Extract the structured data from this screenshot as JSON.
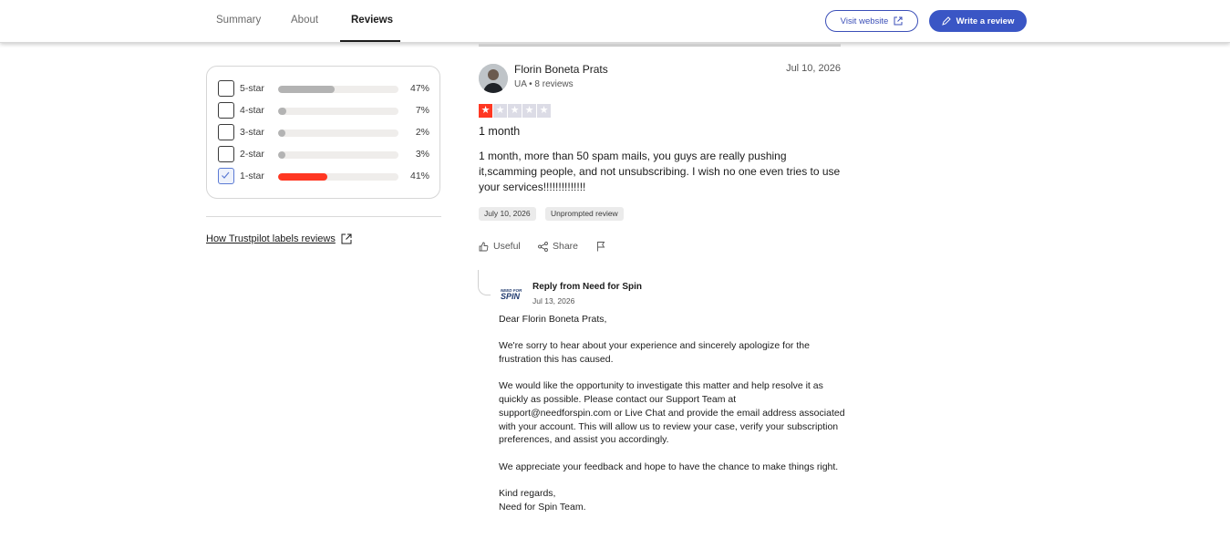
{
  "nav": {
    "tabs": [
      {
        "label": "Summary"
      },
      {
        "label": "About"
      },
      {
        "label": "Reviews"
      }
    ],
    "visit_label": "Visit website",
    "write_label": "Write a review"
  },
  "filters": [
    {
      "label": "5-star",
      "percent": "47%",
      "fraction": 0.47,
      "checked": false,
      "color": "#b3b3b3"
    },
    {
      "label": "4-star",
      "percent": "7%",
      "fraction": 0.07,
      "checked": false,
      "color": "#b3b3b3"
    },
    {
      "label": "3-star",
      "percent": "2%",
      "fraction": 0.02,
      "checked": false,
      "color": "#b3b3b3"
    },
    {
      "label": "2-star",
      "percent": "3%",
      "fraction": 0.03,
      "checked": false,
      "color": "#b3b3b3"
    },
    {
      "label": "1-star",
      "percent": "41%",
      "fraction": 0.41,
      "checked": true,
      "color": "#ff3722"
    }
  ],
  "how_label": "How Trustpilot labels reviews",
  "review": {
    "name": "Florin Boneta Prats",
    "meta": "UA • 8 reviews",
    "date": "Jul 10, 2026",
    "rating": 1,
    "title": "1 month",
    "body": "1 month, more than 50 spam mails, you guys are really pushing it,scamming people, and not unsubscribing. I wish no one even tries to use your services!!!!!!!!!!!!!!",
    "tag_date": "July 10, 2026",
    "tag_type": "Unprompted review",
    "useful_label": "Useful",
    "share_label": "Share"
  },
  "reply": {
    "logo_text_1": "NEED FOR",
    "logo_text_2": "SPIN",
    "title": "Reply from Need for Spin",
    "date": "Jul 13, 2026",
    "paragraphs": [
      "Dear Florin Boneta Prats,",
      "We're sorry to hear about your experience and sincerely apologize for the frustration this has caused.",
      "We would like the opportunity to investigate this matter and help resolve it as quickly as possible. Please contact our Support Team at support@needforspin.com or Live Chat and provide the email address associated with your account. This will allow us to review your case, verify your subscription preferences, and assist you accordingly.",
      "We appreciate your feedback and hope to have the chance to make things right.",
      "Kind regards,\nNeed for Spin Team."
    ]
  },
  "colors": {
    "accent": "#3a56c5",
    "star_on": "#ff3722",
    "star_off": "#dcdce6"
  }
}
